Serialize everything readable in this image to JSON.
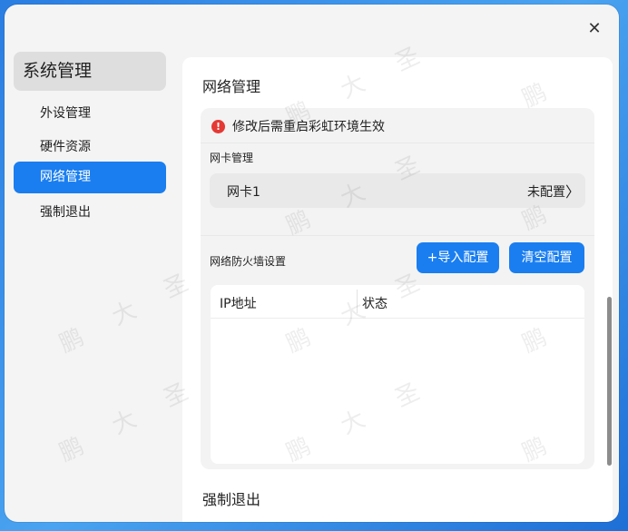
{
  "window": {
    "close_symbol": "✕"
  },
  "sidebar": {
    "title": "系统管理",
    "items": [
      {
        "label": "外设管理",
        "active": false
      },
      {
        "label": "硬件资源",
        "active": false
      },
      {
        "label": "网络管理",
        "active": true
      },
      {
        "label": "强制退出",
        "active": false
      }
    ]
  },
  "main": {
    "title": "网络管理",
    "warning": {
      "icon": "!",
      "text": "修改后需重启彩虹环境生效"
    },
    "nic": {
      "section_label": "网卡管理",
      "name": "网卡1",
      "status": "未配置",
      "chevron": "〉"
    },
    "firewall": {
      "section_label": "网络防火墙设置",
      "import_label": "+导入配置",
      "clear_label": "清空配置",
      "columns": [
        "IP地址",
        "状态"
      ]
    },
    "exit_title": "强制退出"
  },
  "watermark": [
    "鹏",
    "大",
    "圣"
  ],
  "colors": {
    "accent": "#1a7ef0",
    "warning": "#e53935",
    "background": "#2a7de1"
  }
}
